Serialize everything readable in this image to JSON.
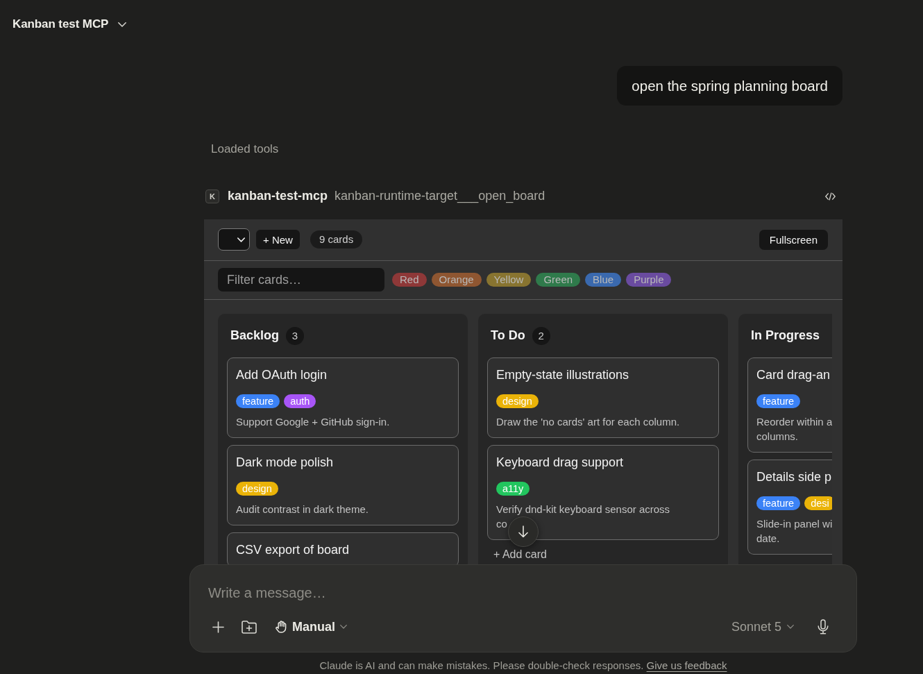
{
  "header": {
    "title": "Kanban test MCP"
  },
  "user_message": {
    "text": "open the spring planning board"
  },
  "tools_status": {
    "label": "Loaded tools"
  },
  "tool_call": {
    "server_initial": "K",
    "server": "kanban-test-mcp",
    "tool": "kanban-runtime-target___open_board"
  },
  "widget": {
    "toolbar": {
      "new_button": "+ New",
      "card_count": "9 cards",
      "fullscreen_button": "Fullscreen"
    },
    "filter": {
      "placeholder": "Filter cards…",
      "chips": [
        {
          "label": "Red",
          "color": "#8e3838",
          "selected": false
        },
        {
          "label": "Orange",
          "color": "#8f5631",
          "selected": false
        },
        {
          "label": "Yellow",
          "color": "#887430",
          "selected": false
        },
        {
          "label": "Green",
          "color": "#2f7a4b",
          "selected": false
        },
        {
          "label": "Blue",
          "color": "#3a69ae",
          "selected": false
        },
        {
          "label": "Purple",
          "color": "#6a4ba0",
          "selected": false
        }
      ]
    },
    "columns": [
      {
        "title": "Backlog",
        "count": "3",
        "cards": [
          {
            "title": "Add OAuth login",
            "tags": [
              {
                "label": "feature",
                "color": "#3b82f6"
              },
              {
                "label": "auth",
                "color": "#a855f7"
              }
            ],
            "description": "Support Google + GitHub sign-in."
          },
          {
            "title": "Dark mode polish",
            "tags": [
              {
                "label": "design",
                "color": "#eab308"
              }
            ],
            "description": "Audit contrast in dark theme."
          },
          {
            "title": "CSV export of board"
          }
        ]
      },
      {
        "title": "To Do",
        "count": "2",
        "cards": [
          {
            "title": "Empty-state illustrations",
            "tags": [
              {
                "label": "design",
                "color": "#eab308"
              }
            ],
            "description": "Draw the 'no cards' art for each column."
          },
          {
            "title": "Keyboard drag support",
            "tags": [
              {
                "label": "a11y",
                "color": "#22c55e"
              }
            ],
            "description": "Verify dnd-kit keyboard sensor across\nco"
          }
        ],
        "add_card": "+ Add card"
      },
      {
        "title": "In Progress",
        "cards": [
          {
            "title": "Card drag-an",
            "tags": [
              {
                "label": "feature",
                "color": "#3b82f6"
              }
            ],
            "description": "Reorder within a\ncolumns."
          },
          {
            "title": "Details side p",
            "tags": [
              {
                "label": "feature",
                "color": "#3b82f6"
              },
              {
                "label": "desi",
                "color": "#eab308"
              }
            ],
            "description": "Slide-in panel wi\ndate."
          }
        ]
      }
    ]
  },
  "composer": {
    "placeholder": "Write a message…",
    "mode": "Manual",
    "model": "Sonnet 5"
  },
  "footer": {
    "text": "Claude is AI and can make mistakes. Please double-check responses.",
    "link": "Give us feedback"
  }
}
